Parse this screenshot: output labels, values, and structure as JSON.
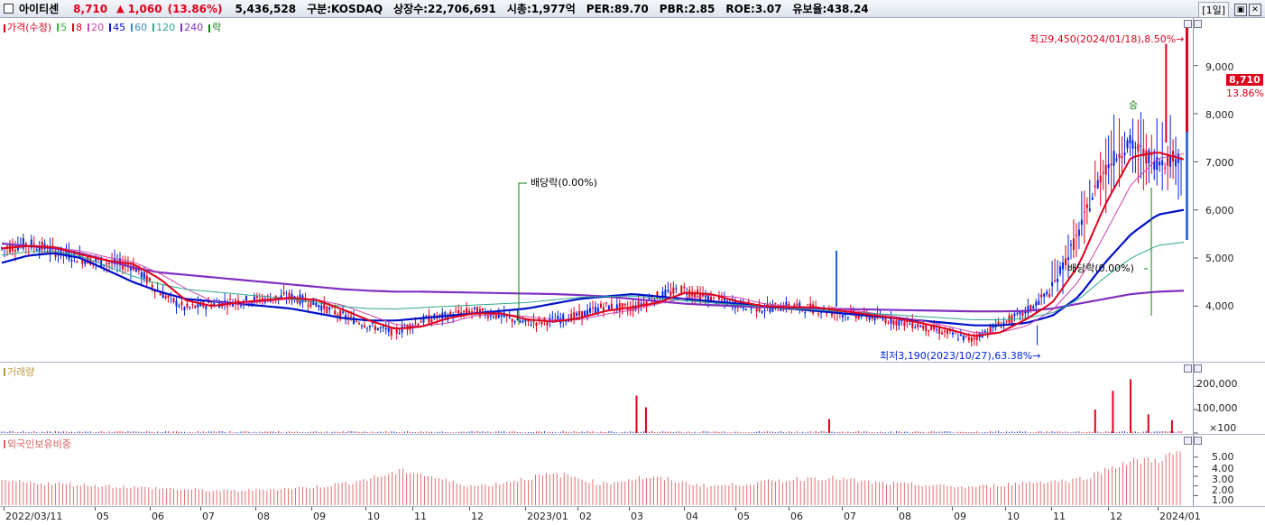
{
  "titlebar": {
    "name": "아이티센",
    "price": "8,710",
    "arrow": "▲",
    "change": "1,060",
    "rate": "(13.86%)",
    "volume": "5,436,528",
    "market": "구분:KOSDAQ",
    "shares": "상장수:22,706,691",
    "mktcap": "시총:1,977억",
    "per": "PER:89.70",
    "pbr": "PBR:2.85",
    "roe": "ROE:3.07",
    "float": "유보율:438.24",
    "period": "[1일]",
    "btn1": "▣",
    "btn2": "✕"
  },
  "legend_price": {
    "price": "가격(수정)",
    "ma5": "5",
    "ma8": "8",
    "ma20": "20",
    "ma45": "45",
    "ma60": "60",
    "ma120": "120",
    "ma240": "240",
    "rak": "락"
  },
  "legend_volume": {
    "label": "거래량"
  },
  "legend_foreign": {
    "label": "외국인보유비중"
  },
  "annotations": {
    "high": "최고9,450(2024/01/18),8.50%→",
    "low": "최저3,190(2023/10/27),63.38%→",
    "div1": "배당락(0.00%)",
    "div2": "배당락(0.00%)",
    "signal": "승"
  },
  "current": {
    "price": "8,710",
    "rate": "13.86%"
  },
  "colors": {
    "up": "#e0001b",
    "down": "#0024e0",
    "ma5": "#22c022",
    "ma8": "#e0001b",
    "ma20": "#cc44aa",
    "ma45": "#0010c8",
    "ma60": "#3a8cc8",
    "ma120": "#2aa890",
    "ma240": "#8030c0",
    "rak": "#108010"
  },
  "chart_data": [
    {
      "type": "candlestick",
      "x_range": [
        "2022/03/11",
        "2024/01"
      ],
      "x_ticks": [
        "2022/03/11",
        "05",
        "06",
        "07",
        "08",
        "09",
        "10",
        "11",
        "12",
        "2023/01",
        "02",
        "03",
        "04",
        "05",
        "06",
        "07",
        "08",
        "09",
        "10",
        "11",
        "12",
        "2024/01"
      ],
      "y_ticks": [
        "9,000",
        "8,000",
        "7,000",
        "6,000",
        "5,000",
        "4,000"
      ],
      "y_tick_values": [
        9000,
        8000,
        7000,
        6000,
        5000,
        4000
      ],
      "ylim": [
        3050,
        9800
      ],
      "close_series": [
        5200,
        5300,
        5150,
        5000,
        4900,
        4850,
        4300,
        3950,
        4050,
        4100,
        4150,
        4200,
        4050,
        3800,
        3600,
        3450,
        3700,
        3800,
        3900,
        3800,
        3650,
        3700,
        3800,
        4000,
        3950,
        4200,
        4350,
        4150,
        4050,
        3950,
        4000,
        3950,
        3850,
        3800,
        3700,
        3600,
        3450,
        3300,
        3600,
        3850,
        4300,
        5400,
        6800,
        7400,
        7000,
        7100
      ],
      "ma45_series": [
        4900,
        5050,
        5100,
        5000,
        4750,
        4500,
        4300,
        4150,
        4100,
        4050,
        4000,
        3950,
        3850,
        3750,
        3700,
        3700,
        3750,
        3800,
        3850,
        3900,
        3950,
        4050,
        4150,
        4200,
        4250,
        4200,
        4150,
        4100,
        4050,
        4000,
        3950,
        3900,
        3850,
        3800,
        3750,
        3700,
        3650,
        3600,
        3600,
        3650,
        3800,
        4200,
        4900,
        5500,
        5900,
        6000
      ],
      "ma240_series": [
        5300,
        5250,
        5200,
        5100,
        4950,
        4800,
        4700,
        4650,
        4600,
        4550,
        4500,
        4450,
        4400,
        4350,
        4320,
        4300,
        4300,
        4290,
        4280,
        4270,
        4260,
        4250,
        4230,
        4200,
        4150,
        4100,
        4050,
        4020,
        4000,
        3980,
        3960,
        3950,
        3940,
        3930,
        3920,
        3910,
        3900,
        3890,
        3890,
        3900,
        3950,
        4050,
        4150,
        4250,
        4300,
        4320
      ],
      "high": {
        "value": 9450,
        "date": "2024/01/18"
      },
      "low": {
        "value": 3190,
        "date": "2023/10/27"
      }
    },
    {
      "type": "bar",
      "title": "거래량",
      "y_ticks": [
        "200,000",
        "100,000",
        "×100"
      ],
      "y_tick_values": [
        200000,
        100000,
        100
      ],
      "ylim": [
        0,
        270000
      ],
      "spikes": [
        {
          "at": 0.537,
          "value": 160000
        },
        {
          "at": 0.545,
          "value": 110000
        },
        {
          "at": 0.7,
          "value": 60000
        },
        {
          "at": 0.925,
          "value": 100000
        },
        {
          "at": 0.94,
          "value": 180000
        },
        {
          "at": 0.955,
          "value": 230000
        },
        {
          "at": 0.97,
          "value": 80000
        },
        {
          "at": 0.99,
          "value": 55000
        }
      ]
    },
    {
      "type": "bar",
      "title": "외국인보유비중",
      "y_ticks": [
        "5.00",
        "4.00",
        "3.00",
        "2.00",
        "1.00"
      ],
      "y_tick_values": [
        5,
        4,
        3,
        2,
        1
      ],
      "ylim": [
        0,
        6.2
      ],
      "series_pct": [
        2.5,
        2.4,
        2.3,
        2.2,
        2.1,
        2.0,
        1.9,
        1.8,
        1.7,
        1.6,
        1.5,
        1.5,
        1.6,
        1.7,
        1.8,
        2.0,
        2.3,
        2.7,
        3.2,
        3.6,
        3.0,
        2.4,
        2.0,
        2.2,
        2.6,
        3.0,
        3.2,
        2.8,
        2.2,
        2.6,
        2.9,
        2.7,
        2.3,
        2.0,
        2.1,
        2.3,
        2.5,
        2.7,
        2.9,
        2.8,
        2.5,
        2.3,
        2.2,
        2.1,
        2.0,
        1.9,
        2.0,
        2.2,
        2.4,
        2.5,
        2.6,
        3.2,
        4.2,
        4.6,
        4.8,
        5.5
      ]
    }
  ]
}
